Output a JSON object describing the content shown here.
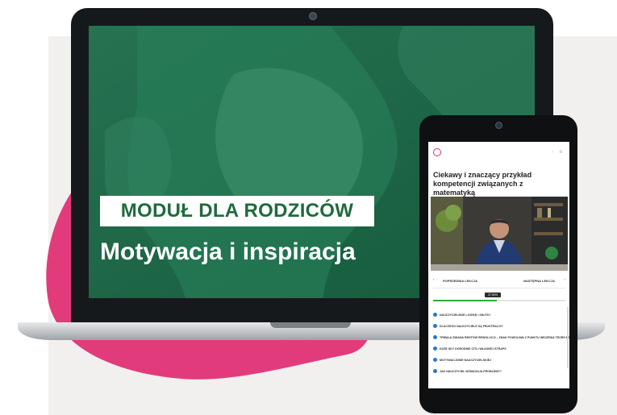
{
  "laptop": {
    "badge": "MODUŁ DLA RODZICÓW",
    "title": "Motywacja i inspiracja"
  },
  "phone": {
    "lesson_title": "Ciekawy i znaczący przykład kompetencji związanych z matematyką",
    "nav": {
      "prev": "POPRZEDNIA LEKCJA",
      "next": "NASTĘPNA LEKCJA"
    },
    "progress_label": "37.50%",
    "progress": 0.48,
    "lessons": [
      "NAUCZYCIELSKIE LOGIKĘ I SKUTKI",
      "DLACZEGO NAUCZYCIELE SĄ FRUSTRACJI?",
      "TRWAŁA ZMIANA RENTÓW REWOLUCJI – ZNAK POWOLIWA Z PUNKTU WIDZENIA TEORII BADAŃ",
      "DUŻE SKY DORODNIE CITLI WŁASNEJ STRAPS",
      "MOTYWACJONIE NAUCZYCIELSKIEJ",
      "JAK NAUCZYCIEL WZMAGAJA PROBLEMY?"
    ]
  },
  "colors": {
    "brand_green": "#1f6b3c",
    "screen_green": "#1e6b4b",
    "accent_pink": "#e23b7c",
    "progress_green": "#2faa3f",
    "lesson_dot": "#2a76d2"
  },
  "icons": [
    "brand-logo-icon",
    "menu-icon",
    "chevron-left-icon",
    "chevron-right-icon",
    "lesson-check-icon"
  ]
}
